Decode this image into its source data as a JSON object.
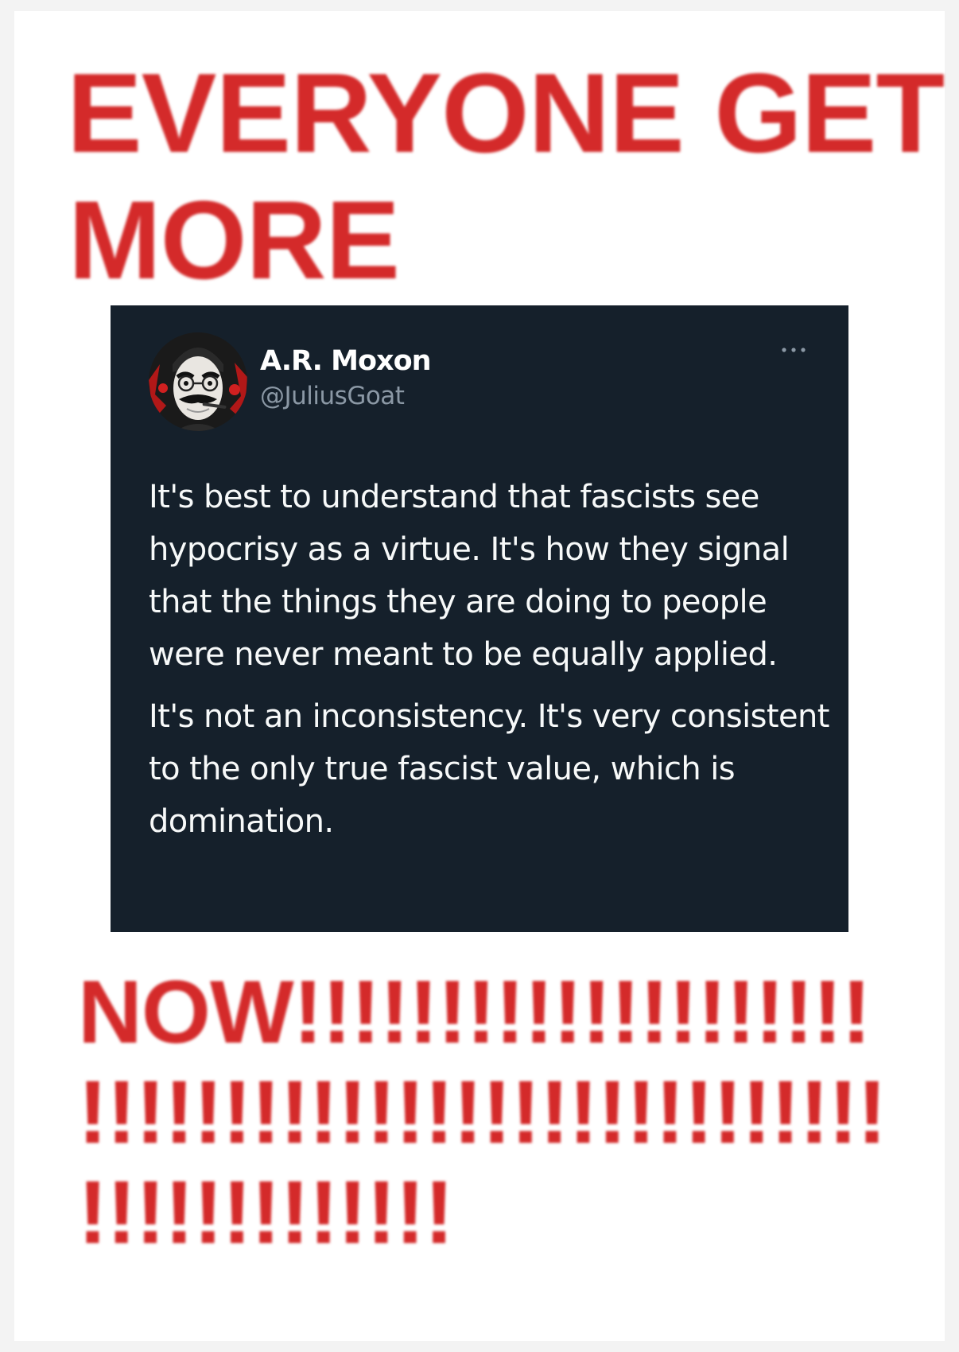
{
  "headline": {
    "line1": "EVERYONE GET",
    "line2": "MORE"
  },
  "tweet": {
    "author_name": "A.R. Moxon",
    "author_handle": "@JuliusGoat",
    "more_icon": "more-options-icon",
    "paragraphs": [
      "It's best to understand that fascists see hypocrisy as a virtue. It's how they signal that the things they are doing to people were never meant to be equally applied.",
      "It's not an inconsistency. It's very consistent to the only true fascist value, which is domination."
    ]
  },
  "footer": {
    "line1": "NOW!!!!!!!!!!!!!!!!!!!!",
    "line2": "!!!!!!!!!!!!!!!!!!!!!!!!!!!!",
    "line3": "!!!!!!!!!!!!!"
  },
  "colors": {
    "headline_red": "#d42a2a",
    "tweet_background": "#15202b",
    "tweet_text": "#f7f9f9",
    "handle_gray": "#8b98a5"
  }
}
